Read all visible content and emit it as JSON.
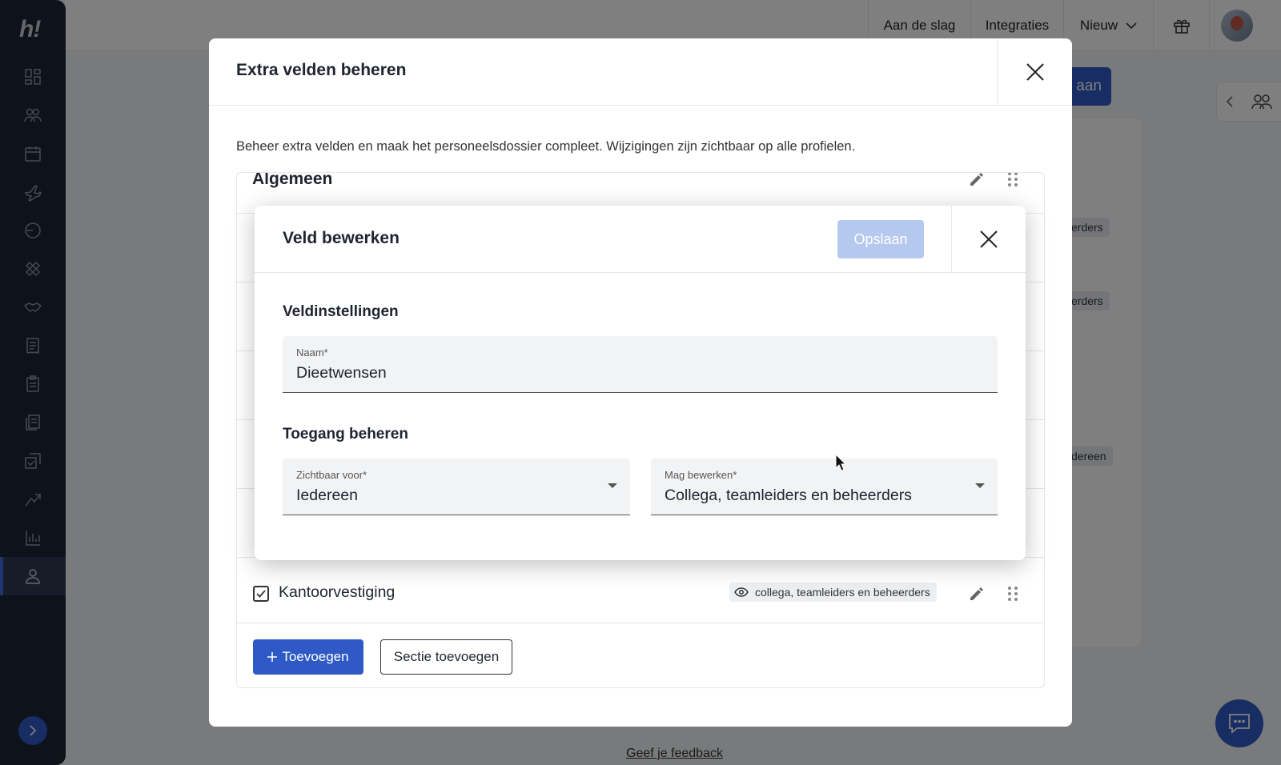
{
  "topbar": {
    "nav": [
      {
        "label": "Aan de slag"
      },
      {
        "label": "Integraties"
      },
      {
        "label": "Nieuw"
      }
    ]
  },
  "sidebar": {
    "logo": "h!",
    "items": [
      {
        "name": "dashboard-icon"
      },
      {
        "name": "team-icon"
      },
      {
        "name": "calendar-icon"
      },
      {
        "name": "plane-icon"
      },
      {
        "name": "clock-icon"
      },
      {
        "name": "bandage-icon"
      },
      {
        "name": "handshake-icon"
      },
      {
        "name": "receipt-icon"
      },
      {
        "name": "clipboard-icon"
      },
      {
        "name": "documents-icon"
      },
      {
        "name": "tasks-icon"
      },
      {
        "name": "growth-icon"
      },
      {
        "name": "chart-icon"
      },
      {
        "name": "person-icon"
      }
    ]
  },
  "page": {
    "save_partial": "aan",
    "chips": [
      "erders",
      "erders",
      "dereen"
    ],
    "feedback": "Geef je feedback"
  },
  "outer_modal": {
    "title": "Extra velden beheren",
    "description": "Beheer extra velden en maak het personeelsdossier compleet. Wijzigingen zijn zichtbaar op alle profielen.",
    "section_title": "Algemeen",
    "field": {
      "label": "Kantoorvestiging",
      "visibility": "collega, teamleiders en beheerders"
    },
    "add_button": "Toevoegen",
    "add_section_button": "Sectie toevoegen"
  },
  "inner_modal": {
    "title": "Veld bewerken",
    "save_button": "Opslaan",
    "settings_heading": "Veldinstellingen",
    "name_field": {
      "label": "Naam*",
      "value": "Dieetwensen"
    },
    "access_heading": "Toegang beheren",
    "visible_for": {
      "label": "Zichtbaar voor*",
      "value": "Iedereen"
    },
    "may_edit": {
      "label": "Mag bewerken*",
      "value": "Collega, teamleiders en beheerders"
    }
  },
  "colors": {
    "sidebar": "#1c2436",
    "primary": "#2f5ac6",
    "save_disabled": "#b5c8ee"
  }
}
